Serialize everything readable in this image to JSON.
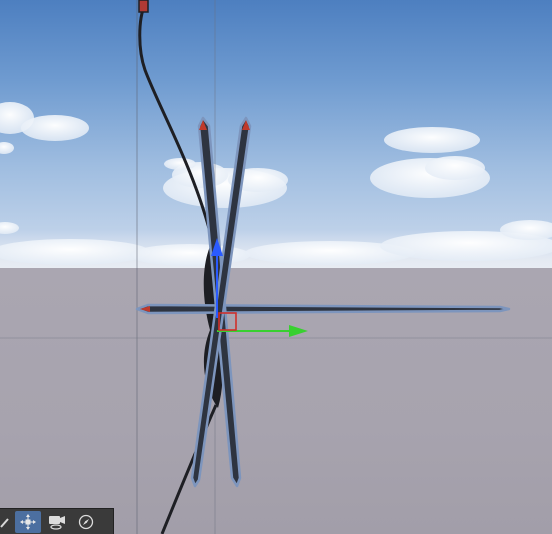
{
  "viewport": {
    "colors": {
      "sky_top": "#4d7fc0",
      "ground": "#a9a5b0",
      "bone_fill": "#2e3440",
      "bone_outline": "#7d95bd",
      "bone_tip": "#c0392b",
      "gizmo_up": "#2a5bff",
      "gizmo_right": "#38d030",
      "gizmo_center": "#d0302a"
    }
  },
  "toolbar": {
    "tools": [
      {
        "icon": "pan-tool-icon",
        "active": false
      },
      {
        "icon": "move-gizmo-icon",
        "active": true
      },
      {
        "icon": "camera-view-icon",
        "active": false
      },
      {
        "icon": "compass-icon",
        "active": false
      }
    ]
  }
}
